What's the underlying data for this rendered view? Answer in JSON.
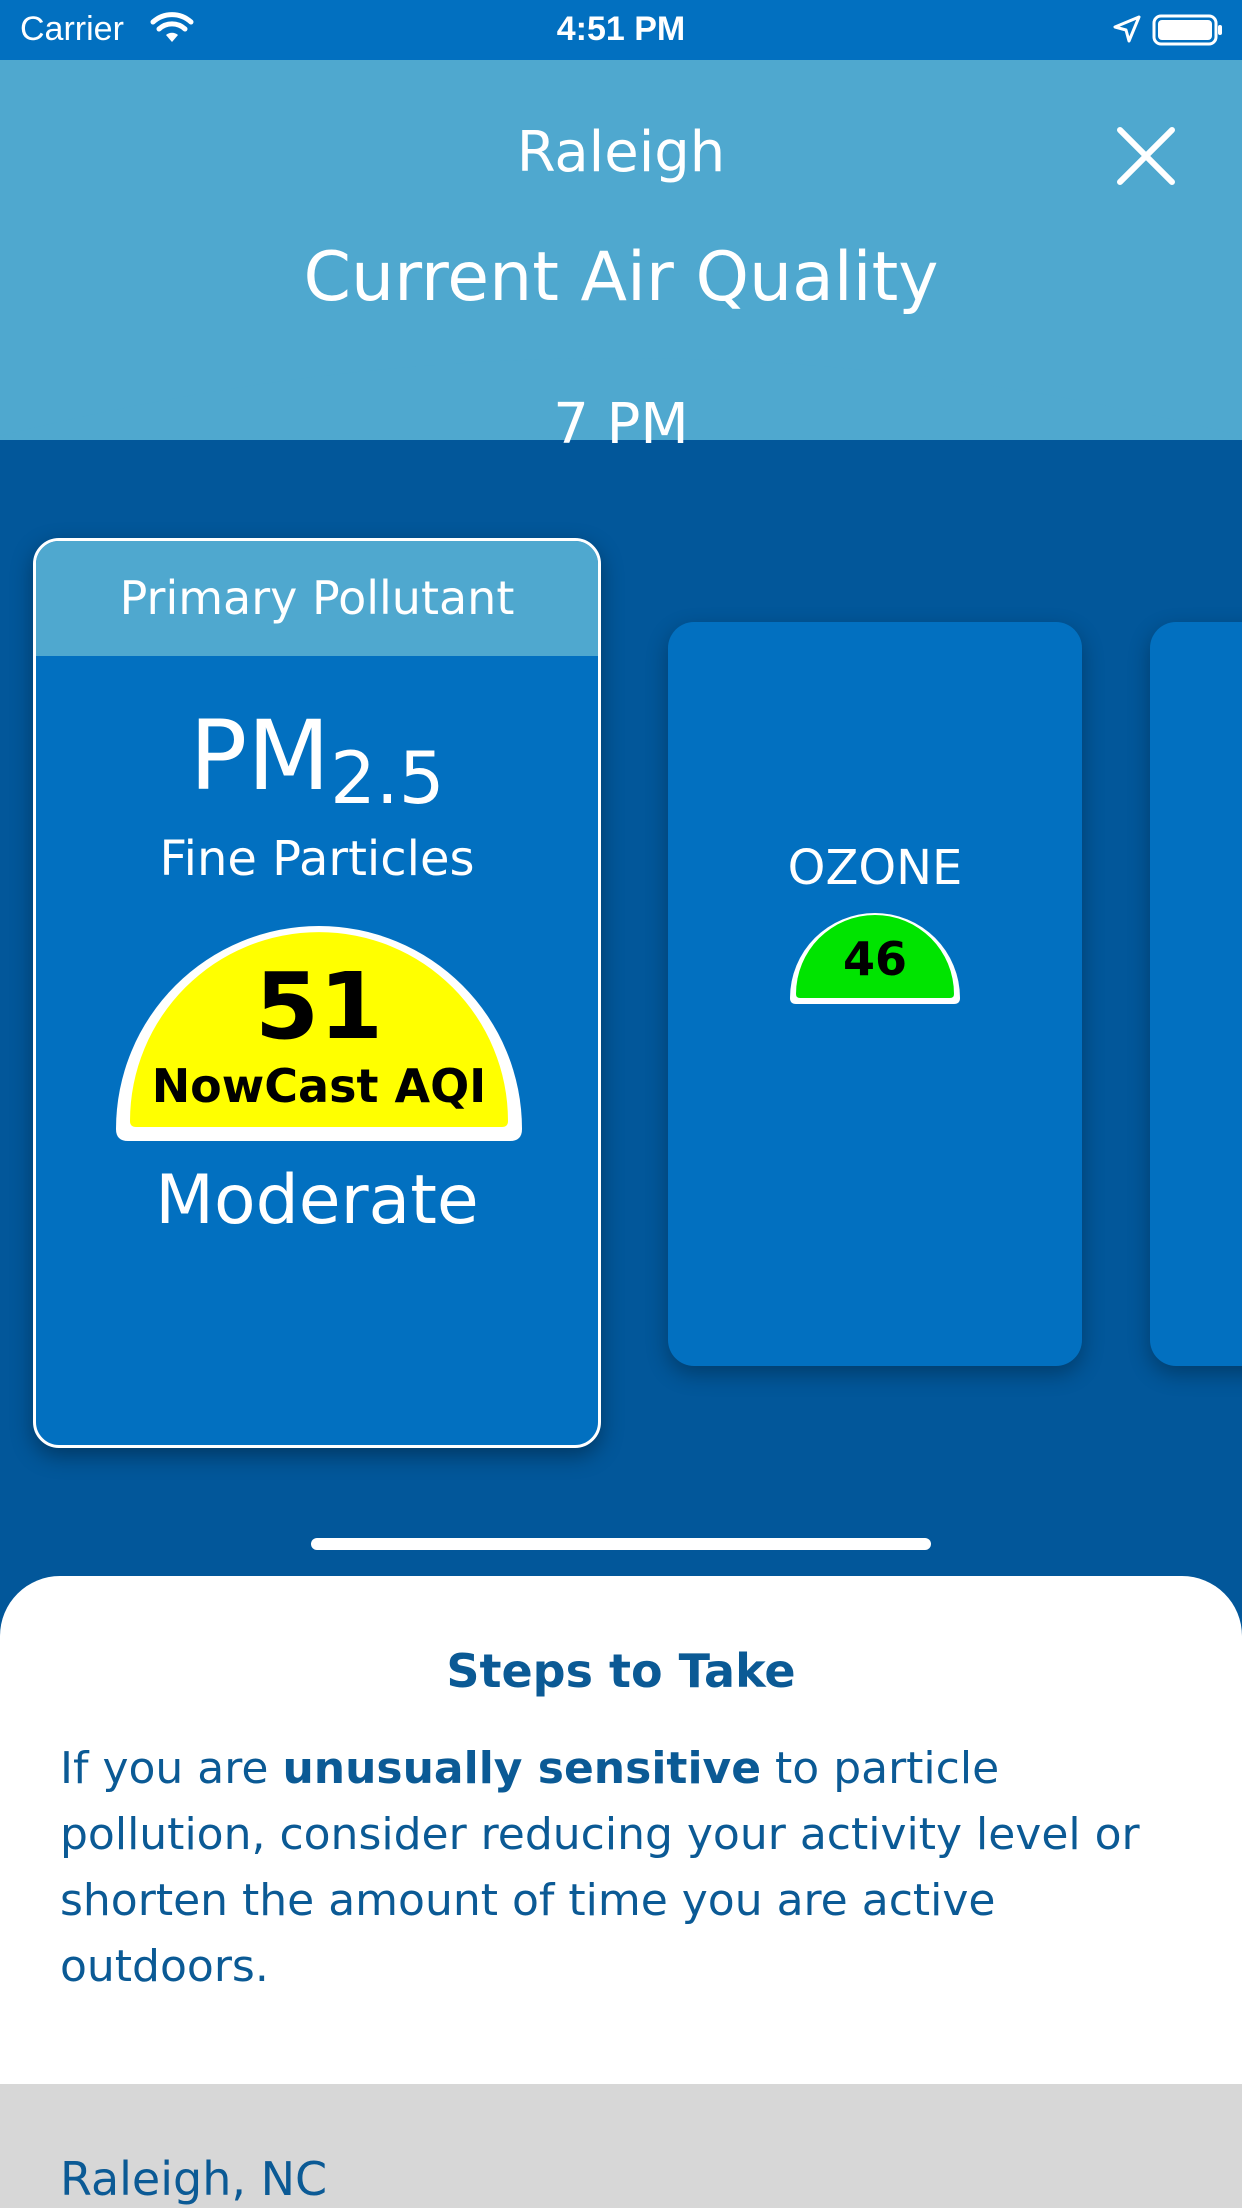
{
  "status_bar": {
    "carrier": "Carrier",
    "time": "4:51 PM",
    "icons": [
      "wifi-icon",
      "location-arrow-icon",
      "battery-icon"
    ]
  },
  "header": {
    "city": "Raleigh",
    "title": "Current Air Quality",
    "time": "7 PM",
    "close_icon": "close-icon"
  },
  "primary_card": {
    "header": "Primary Pollutant",
    "pollutant_symbol": "PM",
    "pollutant_subscript": "2.5",
    "pollutant_name": "Fine Particles",
    "aqi_value": "51",
    "aqi_label": "NowCast AQI",
    "category": "Moderate",
    "aqi_color": "#ffff00"
  },
  "secondary_cards": [
    {
      "pollutant": "OZONE",
      "aqi_value": "46",
      "aqi_color": "#00e400"
    }
  ],
  "steps": {
    "title": "Steps to Take",
    "text_before": "If you are ",
    "text_bold": "unusually sensitive",
    "text_after": " to particle pollution, consider reducing your activity level or shorten the amount of time you are active outdoors."
  },
  "location": {
    "label": "Raleigh, NC"
  },
  "colors": {
    "status_bar": "#0270c0",
    "header_light_blue": "#4fa8cf",
    "background_dark_blue": "#02579a",
    "card_blue": "#0270c0",
    "text_dark_blue": "#0b5a95",
    "footer_gray": "#d7d7d7"
  }
}
